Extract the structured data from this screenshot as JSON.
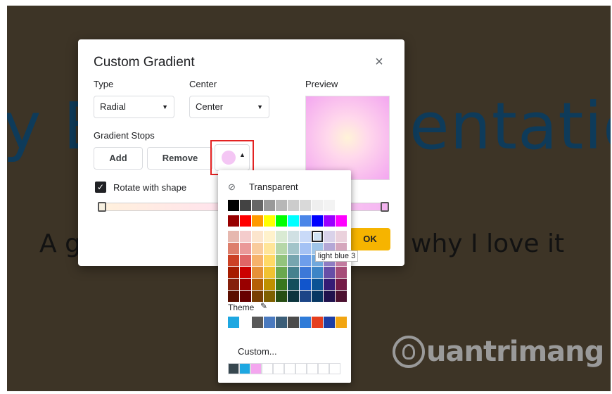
{
  "slide": {
    "title": "y B",
    "title_right": "entatio",
    "subtitle_left": "A g",
    "subtitle_right": "why I love it"
  },
  "watermark": {
    "text": "uantrimang"
  },
  "dialog": {
    "title": "Custom Gradient",
    "close_label": "×",
    "type_label": "Type",
    "type_value": "Radial",
    "center_label": "Center",
    "center_value": "Center",
    "preview_label": "Preview",
    "gradient_stops_label": "Gradient Stops",
    "add_label": "Add",
    "remove_label": "Remove",
    "rotate_label": "Rotate with shape",
    "rotate_checked": true,
    "ok_label": "OK",
    "selected_stop_color": "#f4c6f4"
  },
  "palette": {
    "transparent_label": "Transparent",
    "theme_label": "Theme",
    "custom_label": "Custom...",
    "tooltip": "light blue 3",
    "grays": [
      "#000000",
      "#434343",
      "#666666",
      "#999999",
      "#b7b7b7",
      "#cccccc",
      "#d9d9d9",
      "#efefef",
      "#f3f3f3",
      "#ffffff"
    ],
    "brights": [
      "#980000",
      "#ff0000",
      "#ff9900",
      "#ffff00",
      "#00ff00",
      "#00ffff",
      "#4a86e8",
      "#0000ff",
      "#9900ff",
      "#ff00ff"
    ],
    "shades": [
      [
        "#e6b8af",
        "#f4cccc",
        "#fce5cd",
        "#fff2cc",
        "#d9ead3",
        "#d0e0e3",
        "#c9daf8",
        "#cfe2f3",
        "#d9d2e9",
        "#ead1dc"
      ],
      [
        "#dd7e6b",
        "#ea9999",
        "#f9cb9c",
        "#ffe599",
        "#b6d7a8",
        "#a2c4c9",
        "#a4c2f4",
        "#9fc5e8",
        "#b4a7d6",
        "#d5a6bd"
      ],
      [
        "#cc4125",
        "#e06666",
        "#f6b26b",
        "#ffd966",
        "#93c47d",
        "#76a5af",
        "#6d9eeb",
        "#6fa8dc",
        "#8e7cc3",
        "#c27ba0"
      ],
      [
        "#a61c00",
        "#cc0000",
        "#e69138",
        "#f1c232",
        "#6aa84f",
        "#45818e",
        "#3c78d8",
        "#3d85c6",
        "#674ea7",
        "#a64d79"
      ],
      [
        "#85200c",
        "#990000",
        "#b45f06",
        "#bf9000",
        "#38761d",
        "#134f5c",
        "#1155cc",
        "#0b5394",
        "#351c75",
        "#741b47"
      ],
      [
        "#5b0f00",
        "#660000",
        "#783f04",
        "#7f6000",
        "#274e13",
        "#0c343d",
        "#1c4587",
        "#073763",
        "#20124d",
        "#4c1130"
      ]
    ],
    "theme_colors": [
      "#1ea7e1",
      "#ffffff",
      "#595959",
      "#4a7abf",
      "#3b5e78",
      "#4b4b4b",
      "#2f7bd8",
      "#e53e1e",
      "#1e3fa5",
      "#f2a511"
    ],
    "custom_colors": [
      "#37474f",
      "#1ea7e1",
      "#f4a6ef",
      "#ffffff",
      "#ffffff",
      "#ffffff",
      "#ffffff",
      "#ffffff",
      "#ffffff",
      "#ffffff"
    ]
  }
}
